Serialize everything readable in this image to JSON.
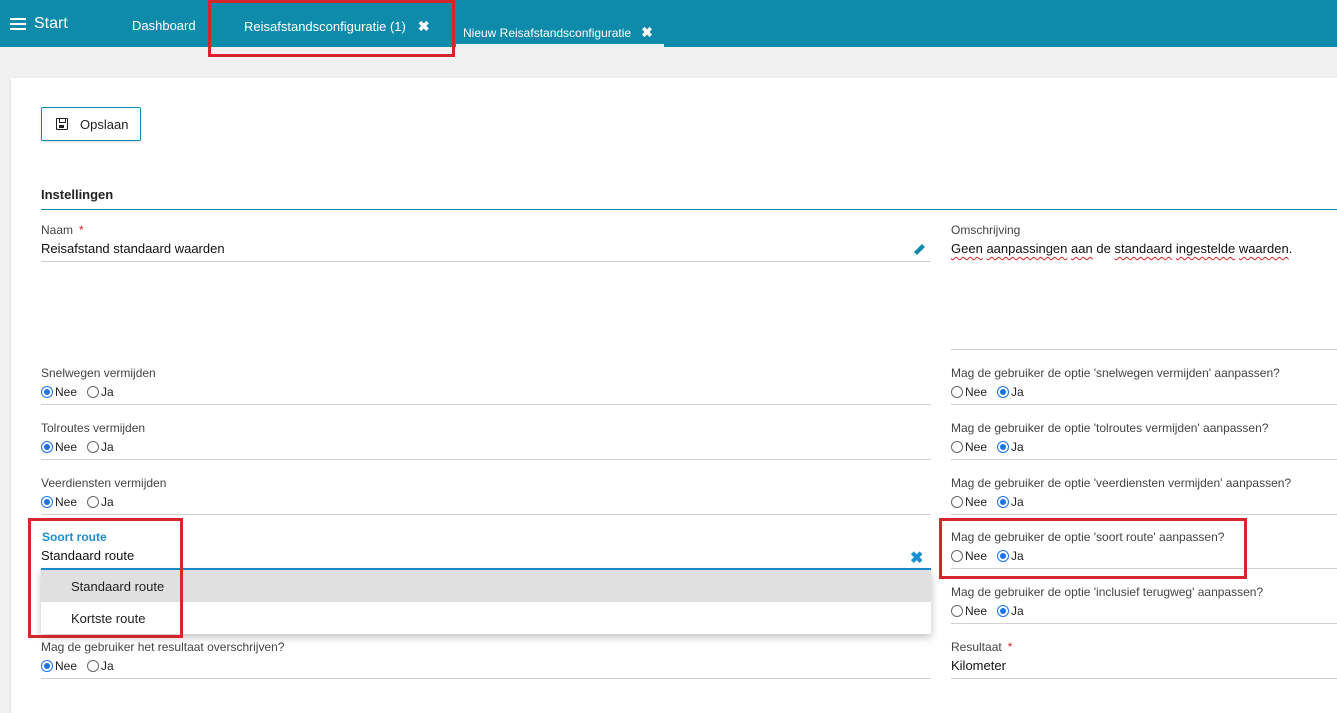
{
  "topbar": {
    "start_label": "Start",
    "tabs": [
      {
        "label": "Dashboard"
      },
      {
        "label": "Reisafstandsconfiguratie (1)",
        "close": "✖"
      },
      {
        "label": "Nieuw Reisafstandsconfiguratie",
        "close": "✖"
      }
    ]
  },
  "toolbar": {
    "save_label": "Opslaan"
  },
  "section": {
    "title": "Instellingen"
  },
  "naam": {
    "label": "Naam",
    "required": "*",
    "value": "Reisafstand standaard waarden"
  },
  "omschrijving": {
    "label": "Omschrijving",
    "words": [
      "Geen",
      "aanpassingen",
      "aan",
      "de",
      "standaard",
      "ingestelde",
      "waarden"
    ],
    "misspelled": [
      true,
      true,
      true,
      false,
      true,
      true,
      true
    ],
    "period": "."
  },
  "radio_options": {
    "nee": "Nee",
    "ja": "Ja"
  },
  "left_fields": [
    {
      "label": "Snelwegen vermijden",
      "selected": "nee"
    },
    {
      "label": "Tolroutes vermijden",
      "selected": "nee"
    },
    {
      "label": "Veerdiensten vermijden",
      "selected": "nee"
    }
  ],
  "right_fields": [
    {
      "label": "Mag de gebruiker de optie 'snelwegen vermijden' aanpassen?",
      "selected": "ja"
    },
    {
      "label": "Mag de gebruiker de optie 'tolroutes vermijden' aanpassen?",
      "selected": "ja"
    },
    {
      "label": "Mag de gebruiker de optie 'veerdiensten vermijden' aanpassen?",
      "selected": "ja"
    },
    {
      "label": "Mag de gebruiker de optie 'soort route' aanpassen?",
      "selected": "ja"
    },
    {
      "label": "Mag de gebruiker de optie 'inclusief terugweg' aanpassen?",
      "selected": "ja"
    }
  ],
  "soort_route": {
    "label": "Soort route",
    "value": "Standaard route",
    "clear": "✖",
    "options": [
      "Standaard route",
      "Kortste route"
    ],
    "selected_index": 0
  },
  "overschrijven": {
    "label": "Mag de gebruiker het resultaat overschrijven?",
    "selected": "nee"
  },
  "resultaat": {
    "label": "Resultaat",
    "required": "*",
    "value": "Kilometer"
  },
  "colors": {
    "brand": "#0e8aab",
    "focus": "#1b8fd4",
    "highlight": "#d6262b"
  }
}
